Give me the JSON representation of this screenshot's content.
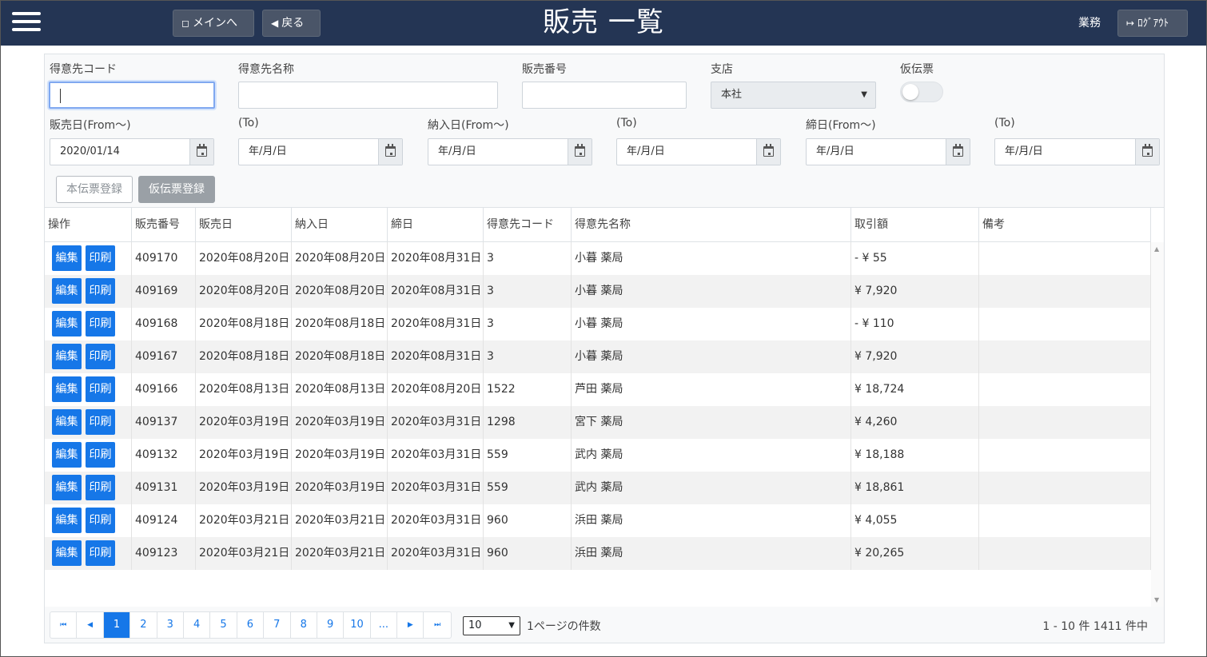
{
  "header": {
    "title": "販売 一覧",
    "main_label": "メインへ",
    "back_label": "戻る",
    "user": "業務",
    "logout_label": "ﾛｸﾞｱｳﾄ"
  },
  "filters": {
    "customer_code_label": "得意先コード",
    "customer_name_label": "得意先名称",
    "sales_no_label": "販売番号",
    "branch_label": "支店",
    "branch_value": "本社",
    "temp_slip_label": "仮伝票",
    "sales_date_from_label": "販売日(From～)",
    "sales_date_from_value": "2020/01/14",
    "sales_date_to_label": "(To)",
    "sales_date_to_value": "年/月/日",
    "delivery_from_label": "納入日(From～)",
    "delivery_from_value": "年/月/日",
    "delivery_to_label": "(To)",
    "delivery_to_value": "年/月/日",
    "closing_from_label": "締日(From～)",
    "closing_from_value": "年/月/日",
    "closing_to_label": "(To)",
    "closing_to_value": "年/月/日"
  },
  "actions": {
    "register_main": "本伝票登録",
    "register_temp": "仮伝票登録"
  },
  "table": {
    "headers": [
      "操作",
      "販売番号",
      "販売日",
      "納入日",
      "締日",
      "得意先コード",
      "得意先名称",
      "取引額",
      "備考"
    ],
    "edit_label": "編集",
    "print_label": "印刷",
    "rows": [
      {
        "no": "409170",
        "date": "2020年08月20日",
        "delivery": "2020年08月20日",
        "closing": "2020年08月31日",
        "code": "3",
        "name": "小暮 薬局",
        "amount": "- ¥ 55",
        "note": ""
      },
      {
        "no": "409169",
        "date": "2020年08月20日",
        "delivery": "2020年08月20日",
        "closing": "2020年08月31日",
        "code": "3",
        "name": "小暮 薬局",
        "amount": "¥ 7,920",
        "note": ""
      },
      {
        "no": "409168",
        "date": "2020年08月18日",
        "delivery": "2020年08月18日",
        "closing": "2020年08月31日",
        "code": "3",
        "name": "小暮 薬局",
        "amount": "- ¥ 110",
        "note": ""
      },
      {
        "no": "409167",
        "date": "2020年08月18日",
        "delivery": "2020年08月18日",
        "closing": "2020年08月31日",
        "code": "3",
        "name": "小暮 薬局",
        "amount": "¥ 7,920",
        "note": ""
      },
      {
        "no": "409166",
        "date": "2020年08月13日",
        "delivery": "2020年08月13日",
        "closing": "2020年08月20日",
        "code": "1522",
        "name": "芦田 薬局",
        "amount": "¥ 18,724",
        "note": ""
      },
      {
        "no": "409137",
        "date": "2020年03月19日",
        "delivery": "2020年03月19日",
        "closing": "2020年03月31日",
        "code": "1298",
        "name": "宮下 薬局",
        "amount": "¥ 4,260",
        "note": ""
      },
      {
        "no": "409132",
        "date": "2020年03月19日",
        "delivery": "2020年03月19日",
        "closing": "2020年03月31日",
        "code": "559",
        "name": "武内 薬局",
        "amount": "¥ 18,188",
        "note": ""
      },
      {
        "no": "409131",
        "date": "2020年03月19日",
        "delivery": "2020年03月19日",
        "closing": "2020年03月31日",
        "code": "559",
        "name": "武内 薬局",
        "amount": "¥ 18,861",
        "note": ""
      },
      {
        "no": "409124",
        "date": "2020年03月21日",
        "delivery": "2020年03月21日",
        "closing": "2020年03月31日",
        "code": "960",
        "name": "浜田 薬局",
        "amount": "¥ 4,055",
        "note": ""
      },
      {
        "no": "409123",
        "date": "2020年03月21日",
        "delivery": "2020年03月21日",
        "closing": "2020年03月31日",
        "code": "960",
        "name": "浜田 薬局",
        "amount": "¥ 20,265",
        "note": ""
      }
    ]
  },
  "pager": {
    "pages": [
      "1",
      "2",
      "3",
      "4",
      "5",
      "6",
      "7",
      "8",
      "9",
      "10",
      "..."
    ],
    "active_page": "1",
    "page_size": "10",
    "page_size_label": "1ページの件数",
    "info": "1 - 10 件 1411 件中"
  },
  "colors": {
    "header_bg": "#243554",
    "primary": "#1677e8"
  }
}
